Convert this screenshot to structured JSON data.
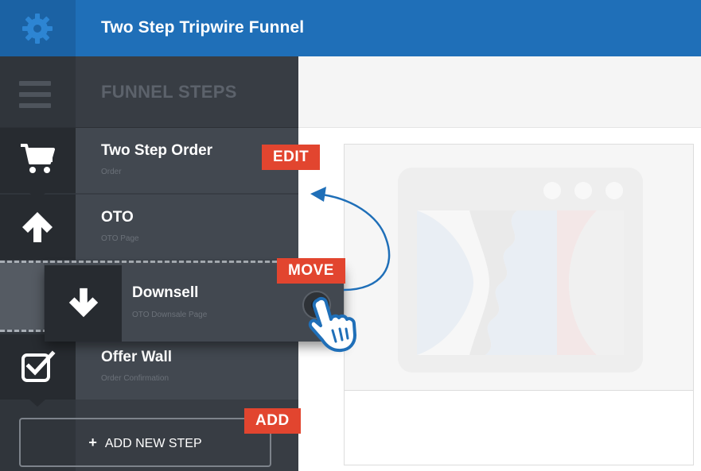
{
  "header": {
    "title": "Two Step Tripwire Funnel",
    "settings_icon": "gear-icon"
  },
  "sidebar": {
    "heading": "FUNNEL STEPS",
    "menu_icon": "hamburger-icon",
    "steps": [
      {
        "title": "Two Step Order",
        "subtitle": "Order",
        "icon": "cart-icon"
      },
      {
        "title": "OTO",
        "subtitle": "OTO Page",
        "icon": "arrow-up-icon"
      },
      {
        "title": "Downsell",
        "subtitle": "OTO Downsale Page",
        "icon": "arrow-down-icon"
      },
      {
        "title": "Offer Wall",
        "subtitle": "Order Confirmation",
        "icon": "checkbox-icon"
      }
    ],
    "add_button": {
      "label": "ADD NEW STEP",
      "plus": "+"
    }
  },
  "callouts": {
    "edit": "EDIT",
    "move": "MOVE",
    "add": "ADD"
  },
  "colors": {
    "header_blue": "#1f6fb8",
    "sidebar_dark": "#383d44",
    "callout_red": "#e2452f",
    "arrow_blue": "#1f6fb8"
  }
}
